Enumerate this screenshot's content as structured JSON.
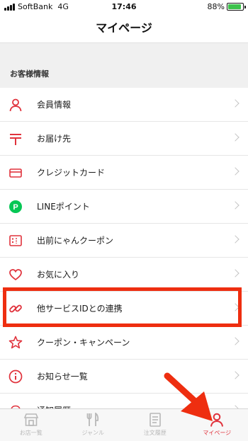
{
  "status_bar": {
    "carrier": "SoftBank",
    "network": "4G",
    "time": "17:46",
    "battery_percent": "88%",
    "battery_level": 0.88
  },
  "header": {
    "title": "マイページ"
  },
  "section": {
    "title": "お客様情報"
  },
  "menu": {
    "items": [
      {
        "label": "会員情報",
        "icon": "person-icon"
      },
      {
        "label": "お届け先",
        "icon": "postal-mark-icon"
      },
      {
        "label": "クレジットカード",
        "icon": "credit-card-icon"
      },
      {
        "label": "LINEポイント",
        "icon": "line-points-icon",
        "icon_letter": "P"
      },
      {
        "label": "出前にゃんクーポン",
        "icon": "coupon-icon"
      },
      {
        "label": "お気に入り",
        "icon": "heart-icon"
      },
      {
        "label": "他サービスIDとの連携",
        "icon": "link-icon"
      },
      {
        "label": "クーポン・キャンペーン",
        "icon": "star-icon"
      },
      {
        "label": "お知らせ一覧",
        "icon": "info-icon"
      },
      {
        "label": "通知履歴",
        "icon": "bell-icon"
      }
    ]
  },
  "tabbar": {
    "tabs": [
      {
        "label": "お店一覧",
        "icon": "store-icon",
        "active": false
      },
      {
        "label": "ジャンル",
        "icon": "cutlery-icon",
        "active": false
      },
      {
        "label": "注文履歴",
        "icon": "receipt-icon",
        "active": false
      },
      {
        "label": "マイページ",
        "icon": "person-icon",
        "active": true
      }
    ]
  },
  "colors": {
    "accent": "#e0323c",
    "annotation": "#ee2e10",
    "line_green": "#06c755",
    "battery_green": "#3cc24b"
  }
}
